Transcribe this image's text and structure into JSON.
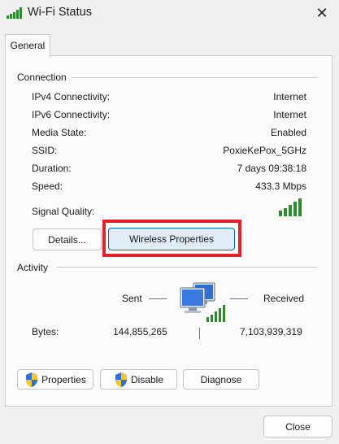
{
  "window": {
    "title": "Wi-Fi Status",
    "close_glyph": "✕"
  },
  "tabs": [
    {
      "label": "General",
      "selected": true
    }
  ],
  "connection": {
    "section_title": "Connection",
    "rows": [
      {
        "label": "IPv4 Connectivity:",
        "value": "Internet"
      },
      {
        "label": "IPv6 Connectivity:",
        "value": "Internet"
      },
      {
        "label": "Media State:",
        "value": "Enabled"
      },
      {
        "label": "SSID:",
        "value": "PoxieKePox_5GHz"
      },
      {
        "label": "Duration:",
        "value": "7 days 09:38:18"
      },
      {
        "label": "Speed:",
        "value": "433.3 Mbps"
      }
    ],
    "signal_quality_label": "Signal Quality:",
    "signal_bars_lit": 5,
    "signal_bars_total": 5
  },
  "buttons": {
    "details": "Details...",
    "wireless_properties": "Wireless Properties"
  },
  "activity": {
    "section_title": "Activity",
    "sent_label": "Sent",
    "received_label": "Received",
    "bytes_label": "Bytes:",
    "bytes_sent": "144,855,265",
    "bytes_received": "7,103,939,319"
  },
  "bottom_buttons": {
    "properties": "Properties",
    "disable": "Disable",
    "diagnose": "Diagnose"
  },
  "footer": {
    "close": "Close"
  },
  "colors": {
    "accent": "#0067c0",
    "highlight": "#e0202a",
    "signal_green": "#2e8b2e"
  }
}
